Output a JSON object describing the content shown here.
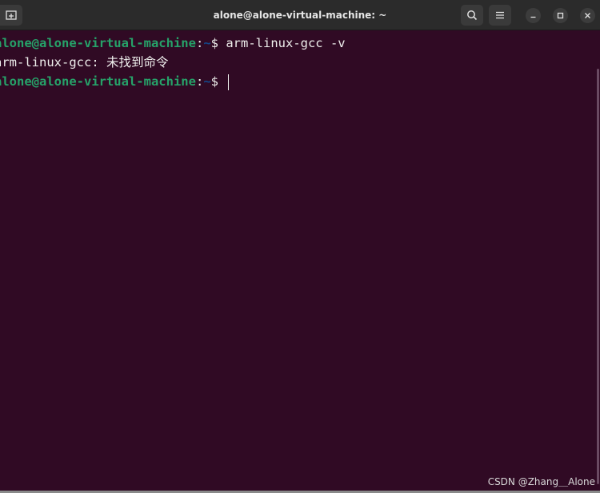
{
  "window": {
    "title": "alone@alone-virtual-machine: ~"
  },
  "titlebar": {
    "new_tab_icon": "new-tab-icon",
    "search_icon": "search-icon",
    "menu_icon": "hamburger-menu-icon",
    "minimize_icon": "minimize-icon",
    "maximize_icon": "maximize-icon",
    "close_icon": "close-icon"
  },
  "terminal": {
    "lines": [
      {
        "user": "alone@alone-virtual-machine",
        "sep": ":",
        "path": "~",
        "prompt": "$ ",
        "command": "arm-linux-gcc -v"
      },
      {
        "output": "arm-linux-gcc: 未找到命令"
      },
      {
        "user": "alone@alone-virtual-machine",
        "sep": ":",
        "path": "~",
        "prompt": "$ ",
        "command": ""
      }
    ]
  },
  "watermark": "CSDN @Zhang＿Alone",
  "colors": {
    "background": "#300a24",
    "prompt_user": "#26a269",
    "prompt_path": "#12488b",
    "text": "#eeeeec"
  }
}
